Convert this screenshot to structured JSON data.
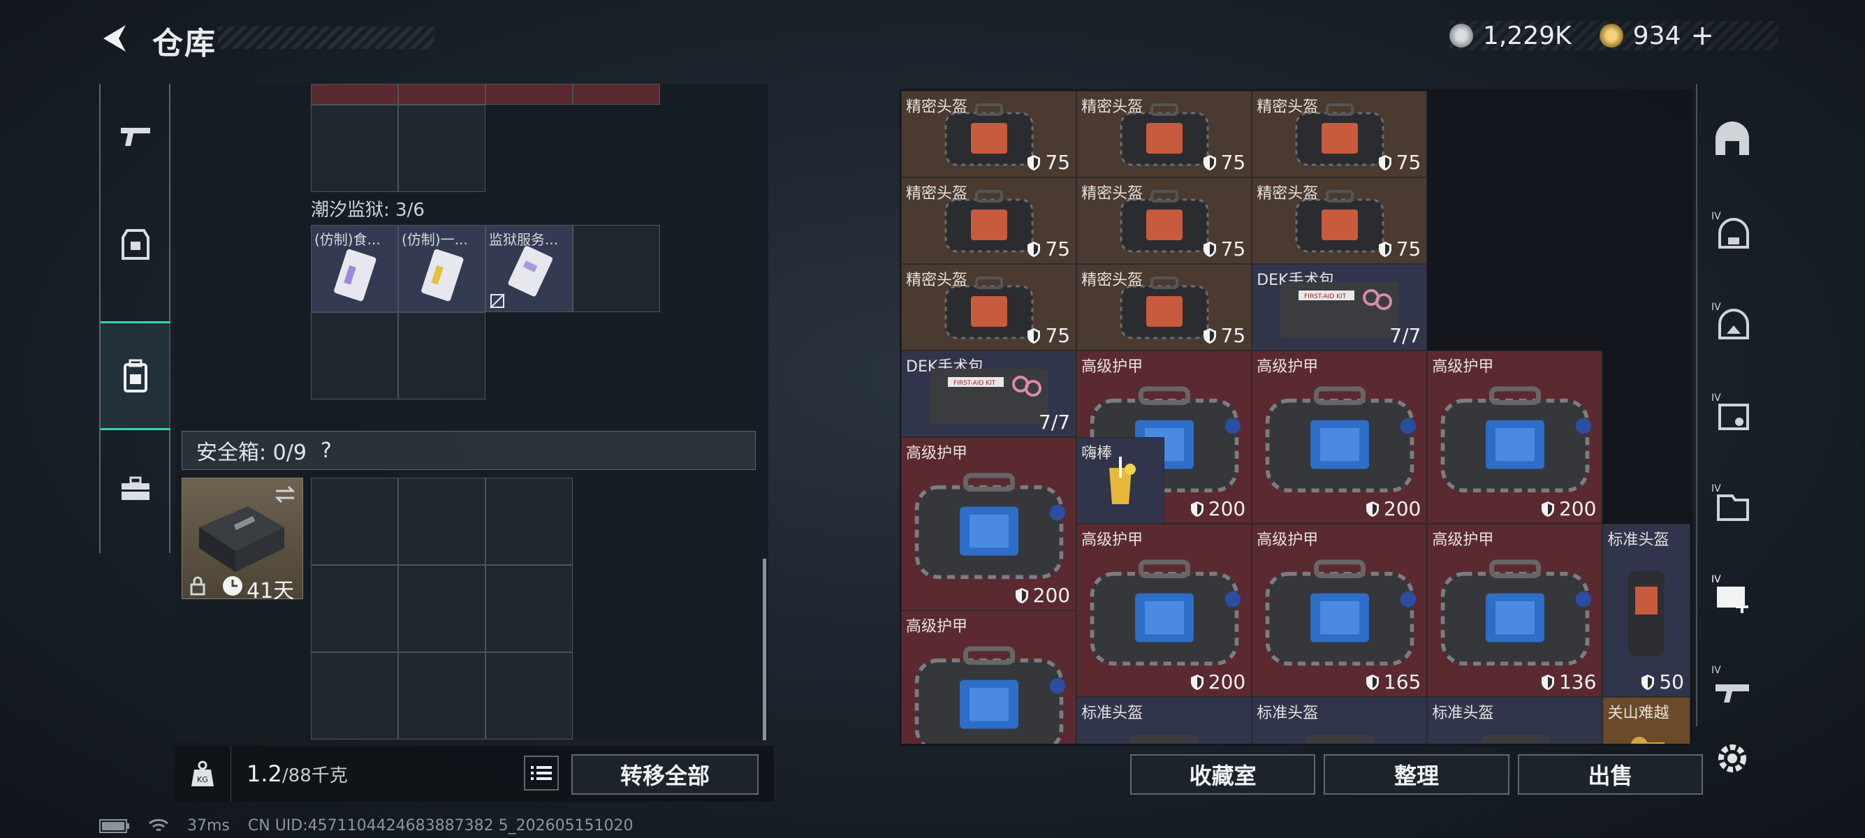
{
  "header": {
    "title": "仓库"
  },
  "currency": {
    "silver": "1,229K",
    "gold": "934",
    "plus": "+"
  },
  "left_categories": [
    {
      "name": "weapon-icon"
    },
    {
      "name": "armor-vest-icon"
    },
    {
      "name": "backpack-icon"
    },
    {
      "name": "toolbox-icon"
    }
  ],
  "left_panel": {
    "section_label": "潮汐监狱: 3/6",
    "items": [
      {
        "label": "(仿制)食..."
      },
      {
        "label": "(仿制)一..."
      },
      {
        "label": "监狱服务..."
      }
    ],
    "safe_box": {
      "label": "安全箱: 0/9",
      "help": "?",
      "duration": "41天"
    },
    "weight": {
      "current": "1.2",
      "max": "/88千克"
    },
    "transfer_all": "转移全部"
  },
  "stash_items": [
    {
      "name": "精密头盔",
      "value": "75",
      "color": "brown"
    },
    {
      "name": "精密头盔",
      "value": "75",
      "color": "brown"
    },
    {
      "name": "精密头盔",
      "value": "75",
      "color": "brown"
    },
    {
      "name": "精密头盔",
      "value": "75",
      "color": "brown"
    },
    {
      "name": "精密头盔",
      "value": "75",
      "color": "brown"
    },
    {
      "name": "精密头盔",
      "value": "75",
      "color": "brown"
    },
    {
      "name": "精密头盔",
      "value": "75",
      "color": "brown"
    },
    {
      "name": "精密头盔",
      "value": "75",
      "color": "brown"
    },
    {
      "name": "DEK手术包",
      "value": "7/7",
      "color": "blue"
    },
    {
      "name": "DEK手术包",
      "value": "7/7",
      "color": "blue"
    },
    {
      "name": "高级护甲",
      "value": "200",
      "color": "red"
    },
    {
      "name": "高级护甲",
      "value": "200",
      "color": "red"
    },
    {
      "name": "高级护甲",
      "value": "200",
      "color": "red"
    },
    {
      "name": "高级护甲",
      "value": "200",
      "color": "red"
    },
    {
      "name": "嗨棒",
      "value": "",
      "color": "blue"
    },
    {
      "name": "高级护甲",
      "value": "200",
      "color": "red"
    },
    {
      "name": "高级护甲",
      "value": "165",
      "color": "red"
    },
    {
      "name": "高级护甲",
      "value": "136",
      "color": "red"
    },
    {
      "name": "标准头盔",
      "value": "50",
      "color": "blue"
    },
    {
      "name": "高级护甲",
      "value": "",
      "color": "red"
    },
    {
      "name": "标准头盔",
      "value": "",
      "color": "blue"
    },
    {
      "name": "标准头盔",
      "value": "",
      "color": "blue"
    },
    {
      "name": "标准头盔",
      "value": "",
      "color": "blue"
    },
    {
      "name": "关山难越",
      "value": "",
      "color": "gold"
    }
  ],
  "right_buttons": {
    "collection": "收藏室",
    "sort": "整理",
    "sell": "出售"
  },
  "right_sidebar": [
    "helmet-icon",
    "tier4-helmet-icon",
    "tier4-helmet-icon-2",
    "tier4-armor-icon",
    "tier4-rig-icon",
    "tier4-medkit-icon",
    "tier4-weapon-icon"
  ],
  "status": {
    "ping": "37ms",
    "uid": "CN UID:4571104424683887382 5_202605151020"
  }
}
